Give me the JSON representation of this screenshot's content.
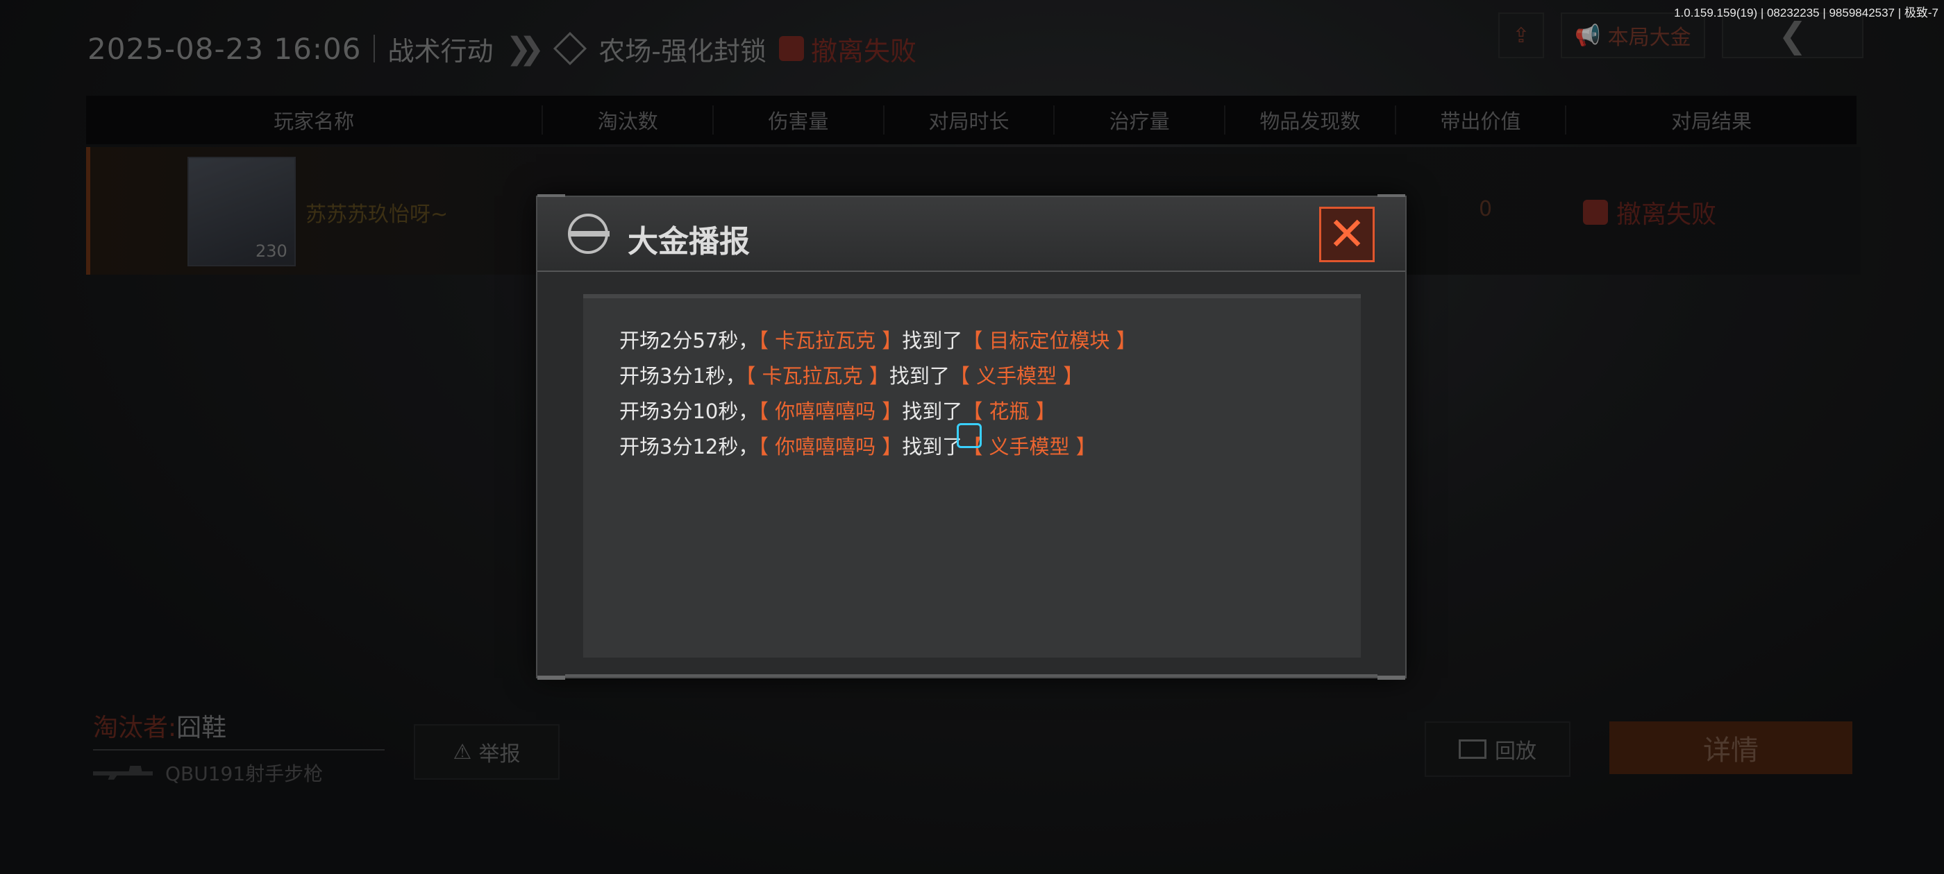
{
  "version": "1.0.159.159(19) | 08232235 | 9859842537 | 极致-7",
  "header": {
    "datetime": "2025-08-23 16:06",
    "mode": "战术行动",
    "map": "农场-强化封锁",
    "result": "撤离失败"
  },
  "top_buttons": {
    "gold_label": "本局大金"
  },
  "columns": [
    "玩家名称",
    "淘汰数",
    "伤害量",
    "对局时长",
    "治疗量",
    "物品发现数",
    "带出价值",
    "对局结果"
  ],
  "player": {
    "name": "苏苏苏玖怡呀~",
    "level": "230",
    "value": "0",
    "result": "撤离失败"
  },
  "eliminator": {
    "label": "淘汰者:",
    "name": "囧鞋",
    "weapon": "QBU191射手步枪"
  },
  "buttons": {
    "report": "举报",
    "replay": "回放",
    "detail": "详情"
  },
  "modal": {
    "title": "大金播报",
    "close": "✕",
    "entries": [
      {
        "time": "开场2分57秒，",
        "player": "【 卡瓦拉瓦克 】",
        "verb": "找到了",
        "item": "【 目标定位模块 】"
      },
      {
        "time": "开场3分1秒，",
        "player": "【 卡瓦拉瓦克 】",
        "verb": "找到了",
        "item": "【 义手模型 】"
      },
      {
        "time": "开场3分10秒，",
        "player": "【 你嘻嘻嘻吗 】",
        "verb": "找到了",
        "item": "【 花瓶 】"
      },
      {
        "time": "开场3分12秒，",
        "player": "【 你嘻嘻嘻吗 】",
        "verb": "找到了",
        "item": "【 义手模型 】"
      }
    ]
  },
  "colors": {
    "accent": "#ec6530",
    "close_border": "#e0562d"
  }
}
